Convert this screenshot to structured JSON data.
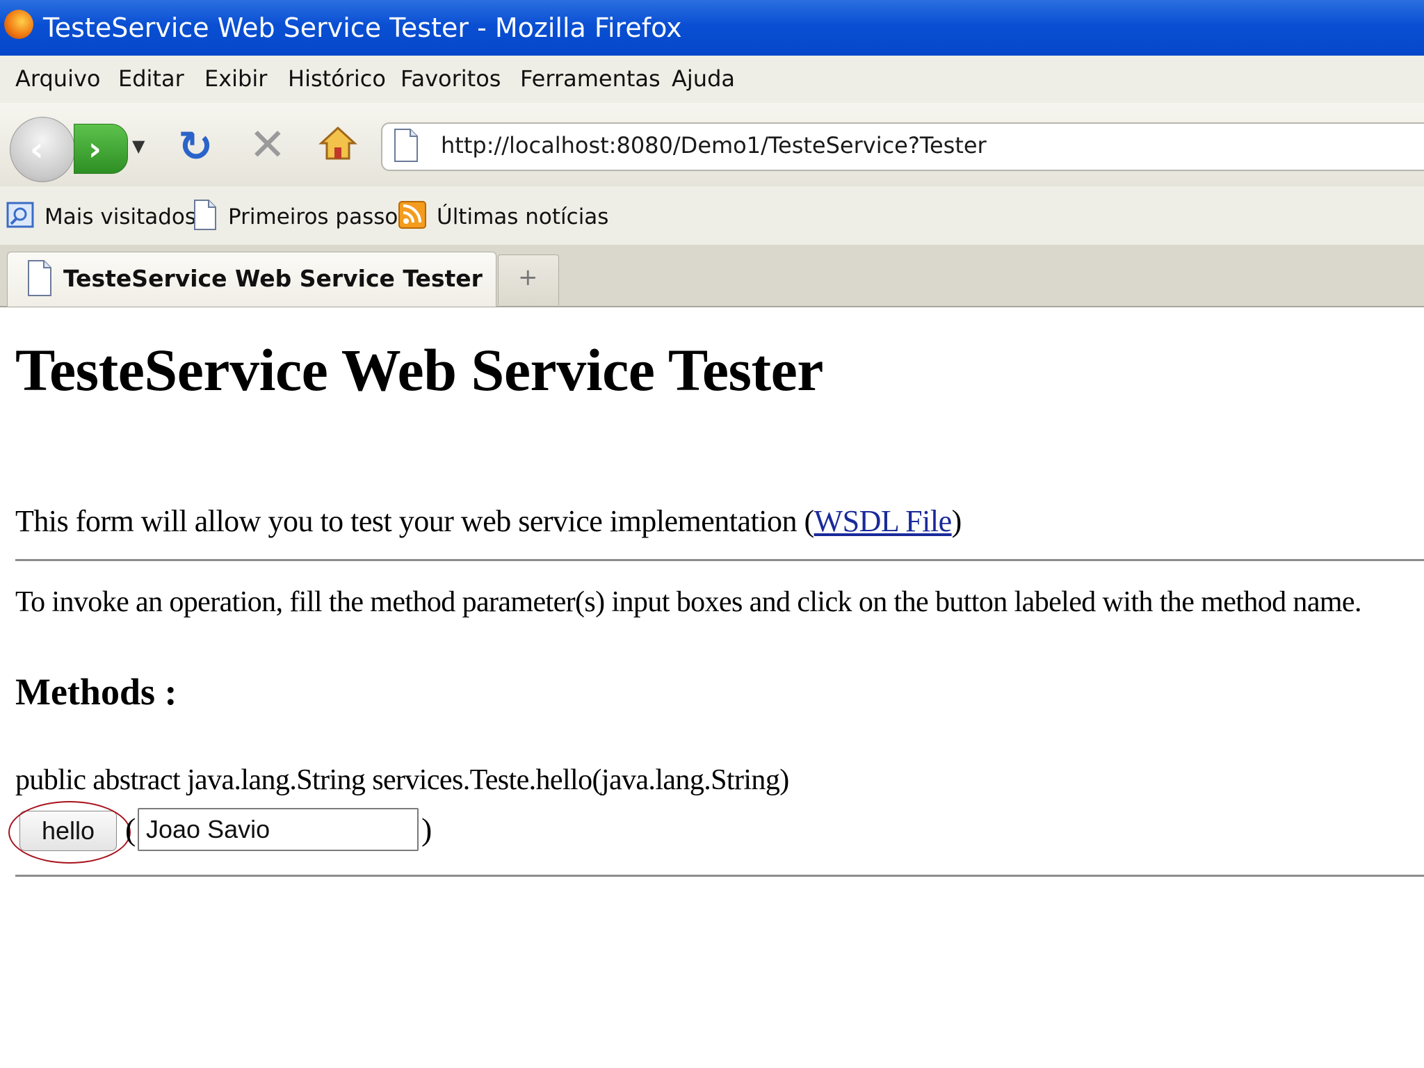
{
  "window": {
    "title": "TesteService Web Service Tester - Mozilla Firefox"
  },
  "menu": {
    "items": [
      "Arquivo",
      "Editar",
      "Exibir",
      "Histórico",
      "Favoritos",
      "Ferramentas",
      "Ajuda"
    ]
  },
  "navigation": {
    "url": "http://localhost:8080/Demo1/TesteService?Tester"
  },
  "bookmarks": {
    "items": [
      {
        "label": "Mais visitados",
        "icon": "most-visited-icon"
      },
      {
        "label": "Primeiros passos",
        "icon": "page-icon"
      },
      {
        "label": "Últimas notícias",
        "icon": "rss-feed-icon"
      }
    ]
  },
  "tabs": {
    "active_label": "TesteService Web Service Tester",
    "new_tab_symbol": "+"
  },
  "page": {
    "title": "TesteService Web Service Tester",
    "intro_text": "This form will allow you to test your web service implementation (",
    "wsdl_link": "WSDL File",
    "intro_close": ")",
    "instructions": "To invoke an operation, fill the method parameter(s) input boxes and click on the button labeled with the method name.",
    "methods_heading": "Methods :",
    "method": {
      "signature": "public abstract java.lang.String services.Teste.hello(java.lang.String)",
      "button_label": "hello",
      "open_paren": "(",
      "close_paren": ")",
      "param_value": "Joao Savio"
    }
  },
  "colors": {
    "titlebar": "#0a4fd3",
    "link": "#1a2a9a",
    "annotation_circle": "#a8111b"
  }
}
